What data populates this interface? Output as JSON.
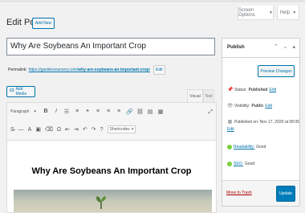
{
  "header": {
    "page_title": "Edit Post",
    "add_new": "Add New",
    "screen_options": "Screen Options",
    "help": "Help"
  },
  "post": {
    "title": "Why Are Soybeans An Important Crop",
    "permalink_label": "Permalink:",
    "permalink_base": "https://gardensnursery.com/",
    "permalink_slug": "why-are-soybeans-an-important-crop",
    "permalink_end": "/",
    "edit_slug": "Edit"
  },
  "editor": {
    "add_media": "Add Media",
    "tab_visual": "Visual",
    "tab_text": "Text",
    "format_select": "Paragraph",
    "shortcodes": "Shortcodes",
    "content_heading": "Why Are Soybeans An Important Crop"
  },
  "publish": {
    "title": "Publish",
    "preview_button": "Preview Changes",
    "status_label": "Status:",
    "status_value": "Published",
    "visibility_label": "Visibility:",
    "visibility_value": "Public",
    "published_on": "Published on: Nov 17, 2020 at 08:05",
    "edit": "Edit",
    "readability_label": "Readability:",
    "readability_value": "Good",
    "seo_label": "SEO:",
    "seo_value": "Good",
    "move_to_trash": "Move to Trash",
    "update_button": "Update"
  },
  "colors": {
    "accent": "#0073aa",
    "primary_button": "#007cba",
    "trash": "#a00000",
    "yoast_good": "#7ad03a"
  }
}
